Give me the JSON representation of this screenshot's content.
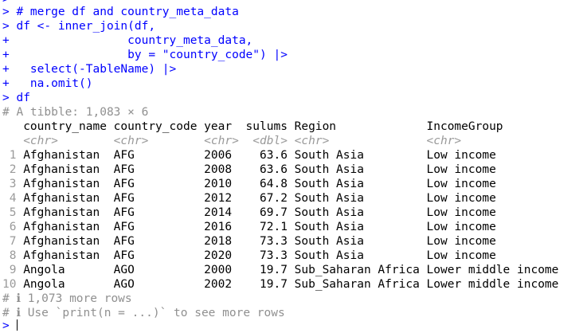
{
  "console": {
    "top_partial": ">",
    "prompt": ">",
    "continuation": "+",
    "commands": [
      {
        "prefix": ">",
        "text": " # merge df and country_meta_data"
      },
      {
        "prefix": ">",
        "text": " df <- inner_join(df,"
      },
      {
        "prefix": "+",
        "text": "                 country_meta_data,"
      },
      {
        "prefix": "+",
        "text": "                 by = \"country_code\") |>"
      },
      {
        "prefix": "+",
        "text": "   select(-TableName) |>"
      },
      {
        "prefix": "+",
        "text": "   na.omit()"
      },
      {
        "prefix": ">",
        "text": " df"
      }
    ],
    "tibble_header": "# A tibble: 1,083 × 6",
    "columns_line": "   country_name country_code year  sulums Region             IncomeGroup",
    "types_line": "   <chr>        <chr>        <chr>  <dbl> <chr>              <chr>",
    "rows": [
      {
        "num": " 1",
        "text": " Afghanistan  AFG          2006    63.6 South Asia         Low income"
      },
      {
        "num": " 2",
        "text": " Afghanistan  AFG          2008    63.6 South Asia         Low income"
      },
      {
        "num": " 3",
        "text": " Afghanistan  AFG          2010    64.8 South Asia         Low income"
      },
      {
        "num": " 4",
        "text": " Afghanistan  AFG          2012    67.2 South Asia         Low income"
      },
      {
        "num": " 5",
        "text": " Afghanistan  AFG          2014    69.7 South Asia         Low income"
      },
      {
        "num": " 6",
        "text": " Afghanistan  AFG          2016    72.1 South Asia         Low income"
      },
      {
        "num": " 7",
        "text": " Afghanistan  AFG          2018    73.3 South Asia         Low income"
      },
      {
        "num": " 8",
        "text": " Afghanistan  AFG          2020    73.3 South Asia         Low income"
      },
      {
        "num": " 9",
        "text": " Angola       AGO          2000    19.7 Sub_Saharan Africa Lower middle income"
      },
      {
        "num": "10",
        "text": " Angola       AGO          2002    19.7 Sub_Saharan Africa Lower middle income"
      }
    ],
    "footer_more": "# ℹ 1,073 more rows",
    "footer_hint": "# ℹ Use `print(n = ...)` to see more rows",
    "final_prompt": ">"
  },
  "colors": {
    "code": "#0000ff",
    "output": "#000000",
    "muted": "#909090"
  }
}
